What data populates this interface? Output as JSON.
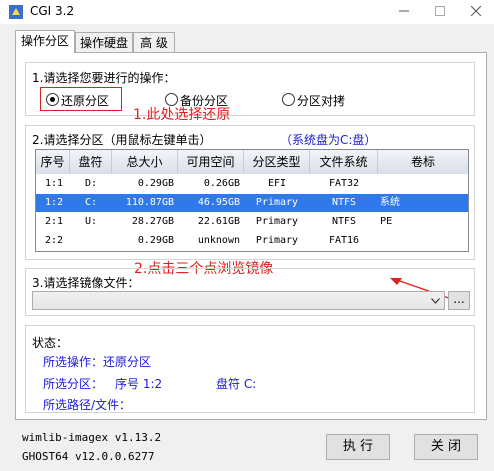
{
  "window": {
    "title": "CGI 3.2"
  },
  "tabs": [
    {
      "label": "操作分区"
    },
    {
      "label": "操作硬盘"
    },
    {
      "label": "高 级"
    }
  ],
  "operation": {
    "prompt": "1.请选择您要进行的操作：",
    "options": [
      {
        "label": "还原分区",
        "selected": true
      },
      {
        "label": "备份分区",
        "selected": false
      },
      {
        "label": "分区对拷",
        "selected": false
      }
    ],
    "annotation": "1.此处选择还原"
  },
  "partition": {
    "prompt": "2.请选择分区（用鼠标左键单击）",
    "system_disk": "（系统盘为C:盘）",
    "columns": [
      "序号",
      "盘符",
      "总大小",
      "可用空间",
      "分区类型",
      "文件系统",
      "卷标"
    ],
    "rows": [
      {
        "index": "1:1",
        "drive": "D:",
        "total": "0.29GB",
        "free": "0.26GB",
        "type": "EFI",
        "fs": "FAT32",
        "label": "",
        "selected": false
      },
      {
        "index": "1:2",
        "drive": "C:",
        "total": "110.87GB",
        "free": "46.95GB",
        "type": "Primary",
        "fs": "NTFS",
        "label": "系统",
        "selected": true
      },
      {
        "index": "2:1",
        "drive": "U:",
        "total": "28.27GB",
        "free": "22.61GB",
        "type": "Primary",
        "fs": "NTFS",
        "label": "PE",
        "selected": false
      },
      {
        "index": "2:2",
        "drive": "",
        "total": "0.29GB",
        "free": "unknown",
        "type": "Primary",
        "fs": "FAT16",
        "label": "",
        "selected": false
      }
    ]
  },
  "image": {
    "annotation": "2.点击三个点浏览镜像",
    "prompt": "3.请选择镜像文件：",
    "value": "",
    "browse_label": "..."
  },
  "status": {
    "heading": "状态：",
    "operation_label": "所选操作：还原分区",
    "partition_label": "所选分区：",
    "partition_index": "序号 1:2",
    "partition_drive": "盘符 C:",
    "path_label": "所选路径/文件："
  },
  "footer": {
    "version1": "wimlib-imagex v1.13.2",
    "version2": "GHOST64 v12.0.0.6277",
    "run_label": "执 行",
    "close_label": "关 闭"
  },
  "colors": {
    "selection": "#3079ed",
    "annotation": "#e02020",
    "info": "#1a1adc"
  }
}
